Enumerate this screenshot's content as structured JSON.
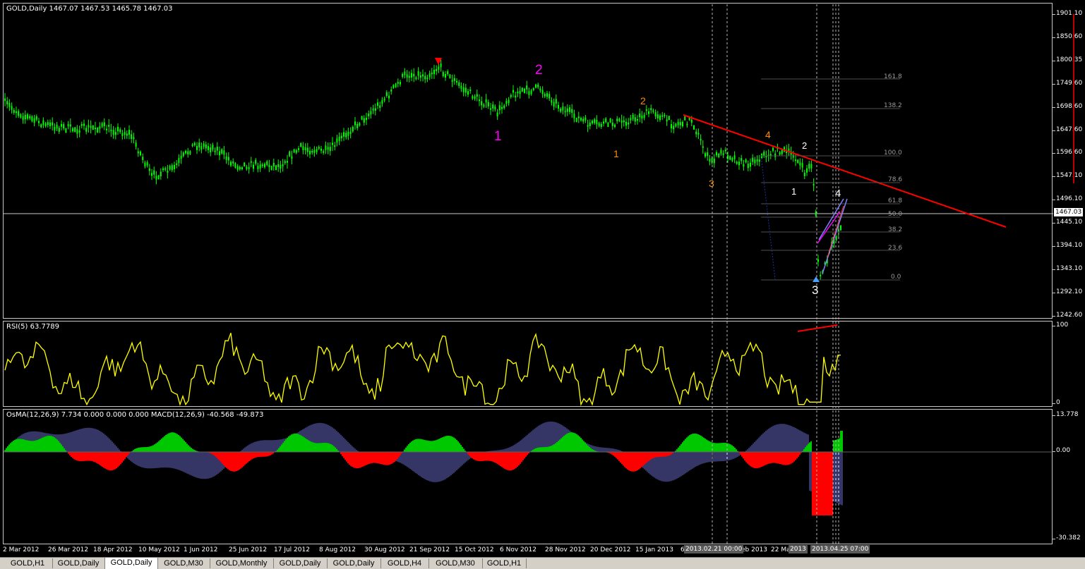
{
  "symbol_info": "GOLD,Daily  1467.07 1467.53 1465.78 1467.03",
  "indicators": {
    "rsi_label": "RSI(5) 63.7789",
    "macd_label": "OsMA(12,26,9) 7.734 0.000 0.000 0.000  MACD(12,26,9) -40.568 -49.873"
  },
  "price_axis": [
    "1901.10",
    "1850.60",
    "1800.35",
    "1749.60",
    "1698.60",
    "1647.60",
    "1596.60",
    "1547.10",
    "1496.10",
    "1445.10",
    "1394.10",
    "1343.10",
    "1292.10",
    "1242.60"
  ],
  "current_price": "1467.03",
  "rsi_axis": [
    "100",
    "0"
  ],
  "macd_axis": [
    "13.778",
    "0.00",
    "-30.382"
  ],
  "time_axis": [
    "2 Mar 2012",
    "26 Mar 2012",
    "18 Apr 2012",
    "10 May 2012",
    "1 Jun 2012",
    "25 Jun 2012",
    "17 Jul 2012",
    "8 Aug 2012",
    "30 Aug 2012",
    "21 Sep 2012",
    "15 Oct 2012",
    "6 Nov 2012",
    "28 Nov 2012",
    "20 Dec 2012",
    "15 Jan 2013",
    "6",
    "eb 2013",
    "22 Ma",
    "2013"
  ],
  "time_markers": [
    "2013.02.21 00:00",
    "2013.04.25 07:00"
  ],
  "fib_levels": [
    "161.8",
    "138.2",
    "100.0",
    "78.6",
    "61.8",
    "50.0",
    "38.2",
    "23.6",
    "0.0"
  ],
  "wave_labels": {
    "magenta": [
      "1",
      "2"
    ],
    "orange": [
      "1",
      "2",
      "3",
      "4"
    ],
    "white": [
      "1",
      "2",
      "3",
      "4"
    ]
  },
  "tabs": [
    "GOLD,H1",
    "GOLD,Daily",
    "GOLD,Daily",
    "GOLD,M30",
    "GOLD,Monthly",
    "GOLD,Daily",
    "GOLD,Daily",
    "GOLD,H4",
    "GOLD,M30",
    "GOLD,H1"
  ],
  "active_tab_index": 2,
  "colors": {
    "candle": "#00ff00",
    "rsi": "#ffff00",
    "trend": "#ff0000",
    "osma_pos": "#00c800",
    "osma_neg": "#ff0000",
    "macd_bar": "#6a6acd",
    "magenta": "#ff00ff",
    "orange": "#ff8c00",
    "grid": "#c8c8c8"
  }
}
